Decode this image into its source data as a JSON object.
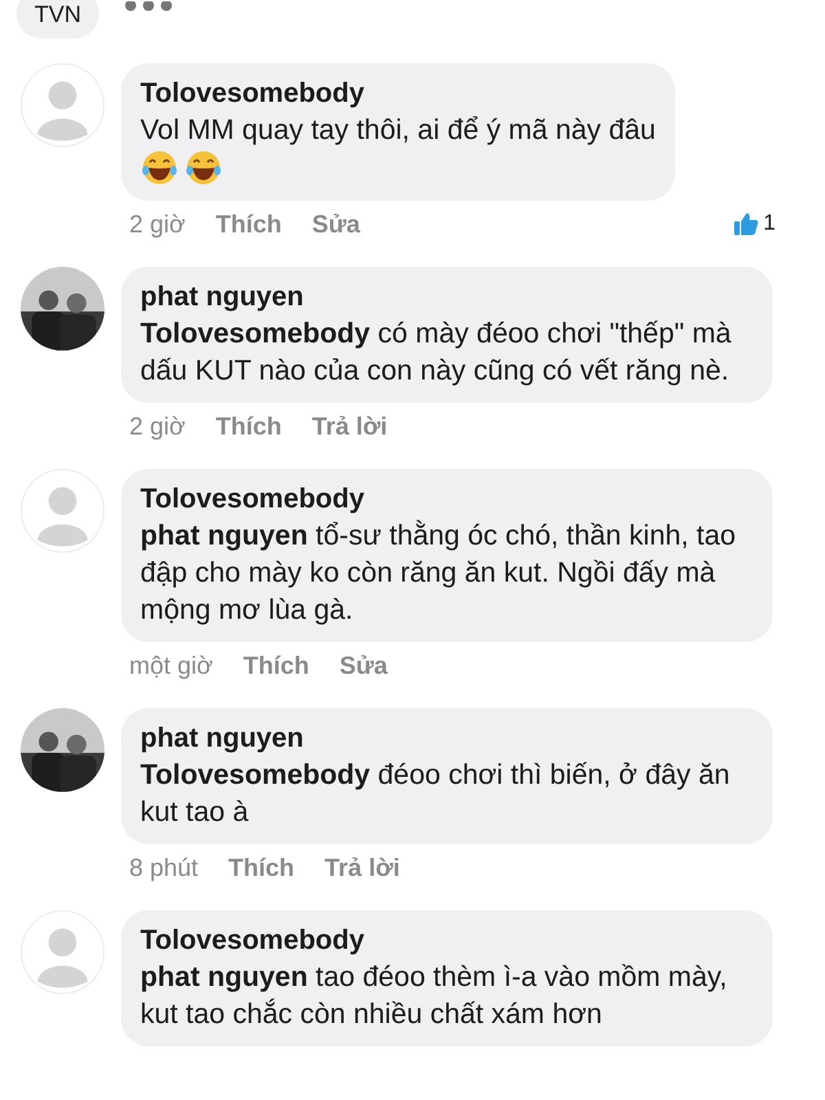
{
  "top_fragment": {
    "text": "TVN"
  },
  "comments": [
    {
      "avatar": {
        "kind": "default"
      },
      "author": "Tolovesomebody",
      "text": "Vol MM quay tay thôi, ai để ý mã này đâu",
      "emojis": [
        {
          "kind": "laugh"
        },
        {
          "kind": "laugh"
        }
      ],
      "time": "2 giờ",
      "like": "Thích",
      "action": "Sửa",
      "reaction_count": "1"
    },
    {
      "author": "phat nguyen",
      "text": "**Tolovesomebody**  có mày đéoo chơi \"thếp\" mà dấu KUT nào của con này cũng có vết răng nè.",
      "time": "2 giờ",
      "like": "Thích",
      "action": "Trả lời"
    },
    {
      "avatar": {
        "kind": "default"
      },
      "author": "Tolovesomebody",
      "text": "**phat nguyen**  tổ-sư thằng óc chó, thần kinh, tao đập cho mày ko còn răng ăn kut. Ngồi đấy mà mộng mơ lùa gà.",
      "time": "một giờ",
      "like": "Thích",
      "action": "Sửa"
    },
    {
      "author": "phat nguyen",
      "text": "**Tolovesomebody**  đéoo chơi thì biến, ở đây ăn kut tao à",
      "time": "8 phút",
      "like": "Thích",
      "action": "Trả lời"
    },
    {
      "avatar": {
        "kind": "default"
      },
      "author": "Tolovesomebody",
      "text": "**phat nguyen**  tao đéoo thèm ì-a vào mồm mày, kut tao chắc còn nhiều chất xám hơn"
    }
  ]
}
